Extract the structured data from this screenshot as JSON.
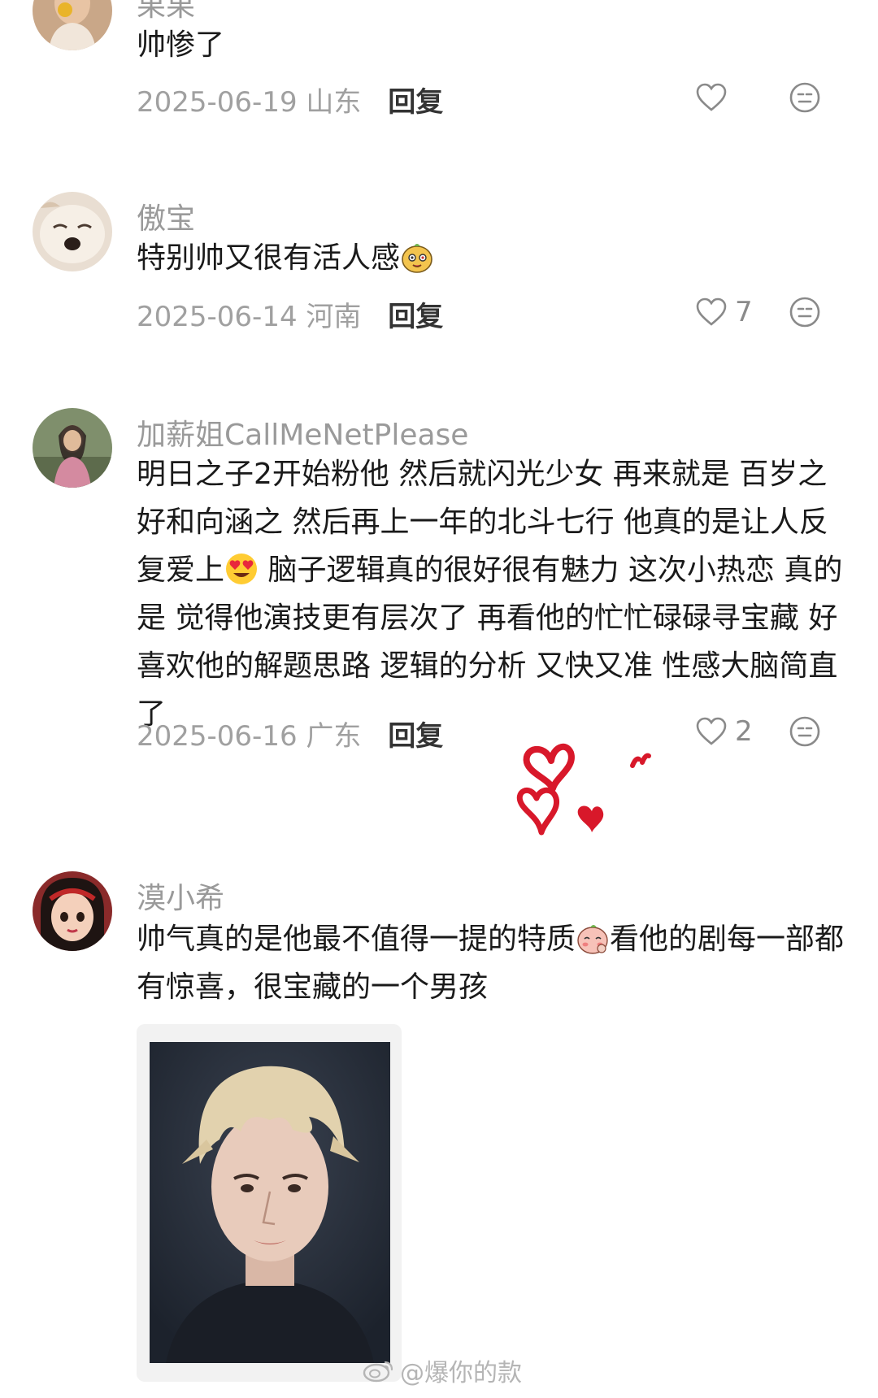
{
  "comments": [
    {
      "username": "果果",
      "text": "帅惨了",
      "date": "2025-06-19",
      "location": "山东",
      "reply_label": "回复",
      "likes": ""
    },
    {
      "username": "傲宝",
      "text": "特别帅又很有活人感",
      "date": "2025-06-14",
      "location": "河南",
      "reply_label": "回复",
      "likes": "7"
    },
    {
      "username": "加薪姐CallMeNetPlease",
      "text_part1": "明日之子2开始粉他 然后就闪光少女 再来就是 百岁之好和向涵之 然后再上一年的北斗七行 他真的是让人反复爱上",
      "text_part2": " 脑子逻辑真的很好很有魅力 这次小热恋 真的是 觉得他演技更有层次了 再看他的忙忙碌碌寻宝藏 好喜欢他的解题思路 逻辑的分析 又快又准 性感大脑简直了",
      "date": "2025-06-16",
      "location": "广东",
      "reply_label": "回复",
      "likes": "2"
    },
    {
      "username": "漠小希",
      "text_part1": "帅气真的是他最不值得一提的特质",
      "text_part2": "看他的剧每一部都有惊喜，很宝藏的一个男孩",
      "has_photo": true
    }
  ],
  "watermark": "@爆你的款",
  "icons": {
    "like": "heart-outline-icon",
    "emoji": "emoji-react-icon",
    "weibo": "weibo-logo-icon"
  },
  "colors": {
    "username": "#9a9a9a",
    "meta": "#a0a0a0",
    "doodle_heart": "#d8182a"
  }
}
